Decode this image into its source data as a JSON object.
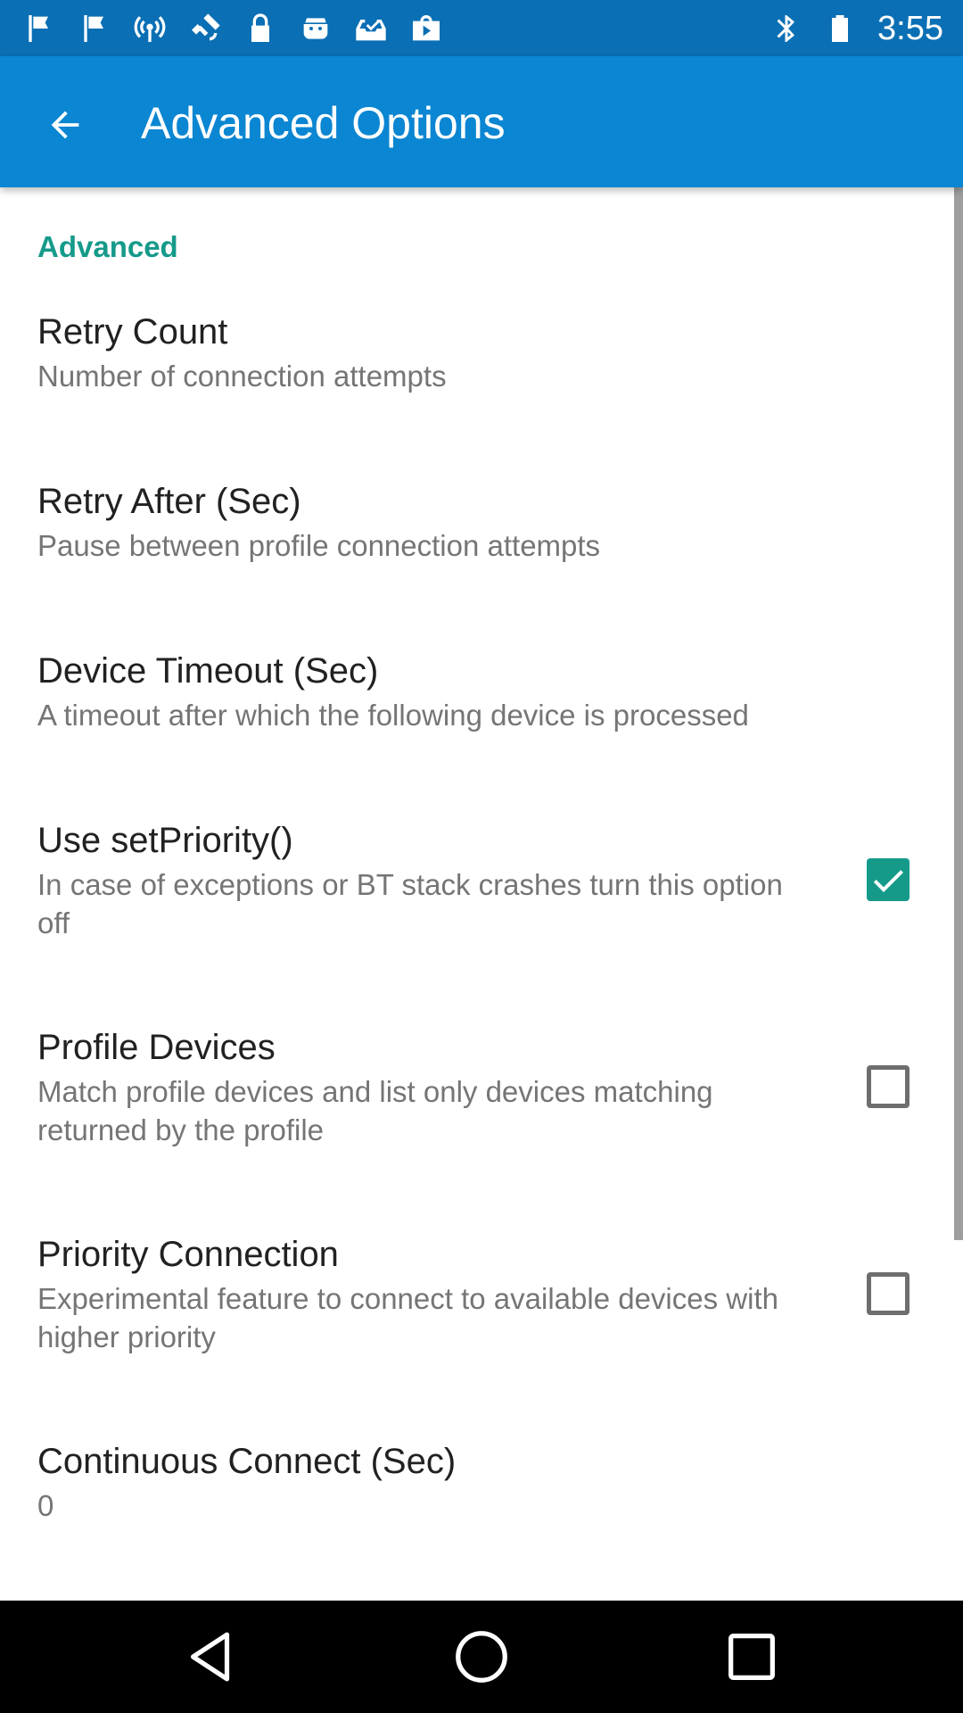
{
  "status_bar": {
    "time": "3:55",
    "icons_left": [
      "flag-icon",
      "flag-icon",
      "hotspot-icon",
      "fake-gps-icon",
      "lock-icon",
      "android-icon",
      "inbox-check-icon",
      "play-store-icon"
    ],
    "icons_right": [
      "bluetooth-icon",
      "battery-icon"
    ]
  },
  "app_bar": {
    "title": "Advanced Options",
    "back_icon": "arrow-back-icon"
  },
  "section": {
    "header": "Advanced"
  },
  "preferences": [
    {
      "title": "Retry Count",
      "summary": "Number of connection attempts"
    },
    {
      "title": "Retry After (Sec)",
      "summary": "Pause between profile connection attempts"
    },
    {
      "title": "Device Timeout (Sec)",
      "summary": "A timeout after which the following device is processed"
    },
    {
      "title": "Use setPriority()",
      "summary": "In case of exceptions or BT stack crashes turn this option off",
      "checked": true
    },
    {
      "title": "Profile Devices",
      "summary": "Match profile devices and list only devices matching returned by the profile",
      "checked": false
    },
    {
      "title": "Priority Connection",
      "summary": "Experimental feature to connect to available devices with higher priority",
      "checked": false
    },
    {
      "title": "Continuous Connect (Sec)",
      "summary": "0"
    }
  ],
  "colors": {
    "status_bar": "#0a6fb4",
    "app_bar": "#0b86d2",
    "accent": "#159a8a",
    "title_text": "#212121",
    "summary_text": "#757575"
  },
  "nav_bar": {
    "icons": [
      "back-triangle-icon",
      "home-circle-icon",
      "recents-square-icon"
    ]
  }
}
